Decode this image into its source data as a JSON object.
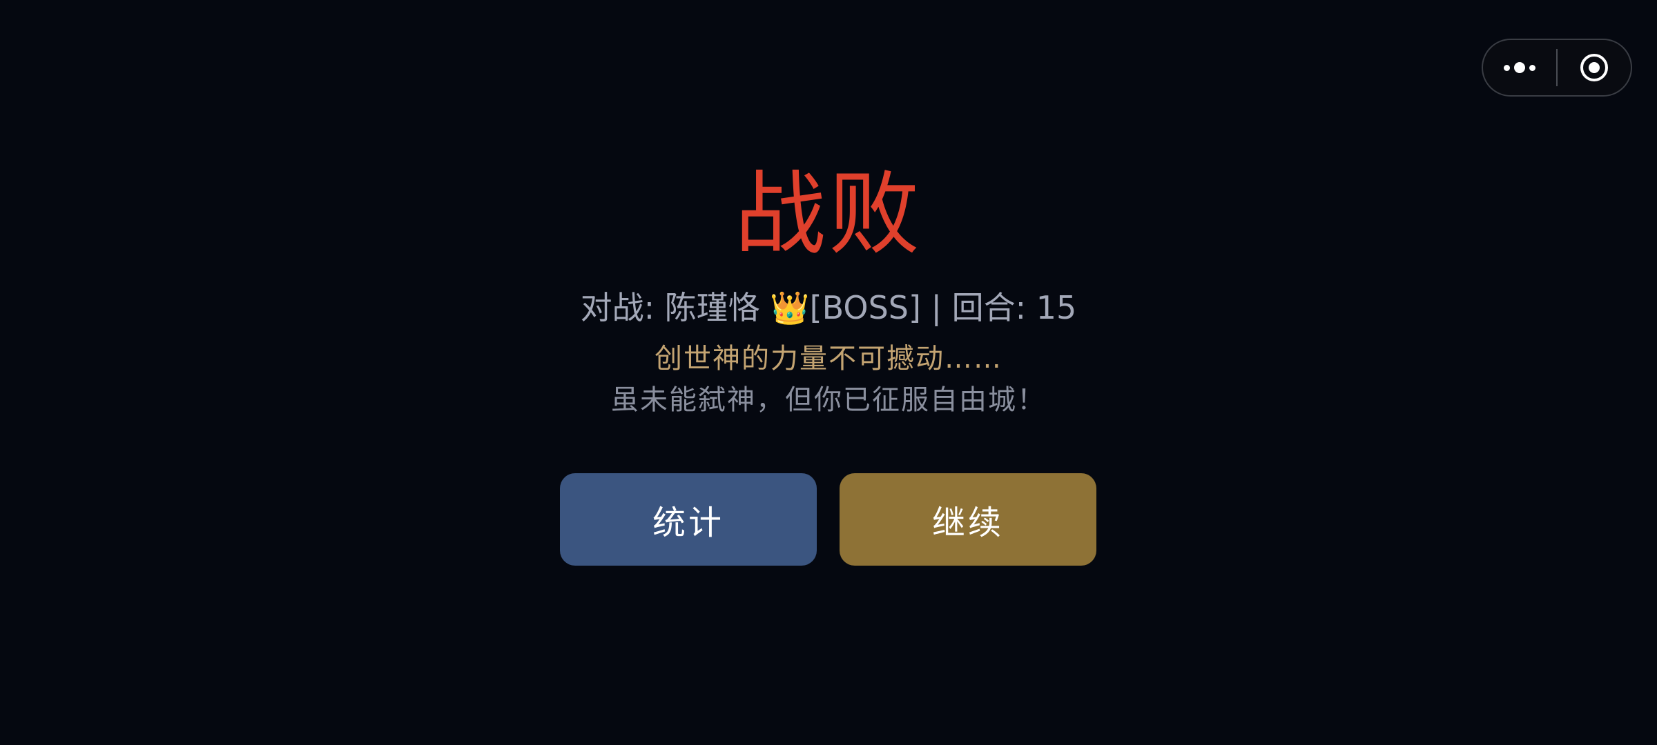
{
  "capsule": {
    "more_icon": "more-dots-icon",
    "close_icon": "target-circle-icon"
  },
  "result": {
    "title": "战败",
    "match_info": "对战: 陈瑾恪 👑[BOSS] | 回合: 15",
    "boss_quote": "创世神的力量不可撼动……",
    "consolation": "虽未能弑神，但你已征服自由城！"
  },
  "buttons": {
    "stats_label": "统计",
    "continue_label": "继续"
  },
  "colors": {
    "background": "#050810",
    "title": "#e0402c",
    "stats_button": "#3b5580",
    "continue_button": "#8e7236",
    "quote": "#c4a472"
  }
}
